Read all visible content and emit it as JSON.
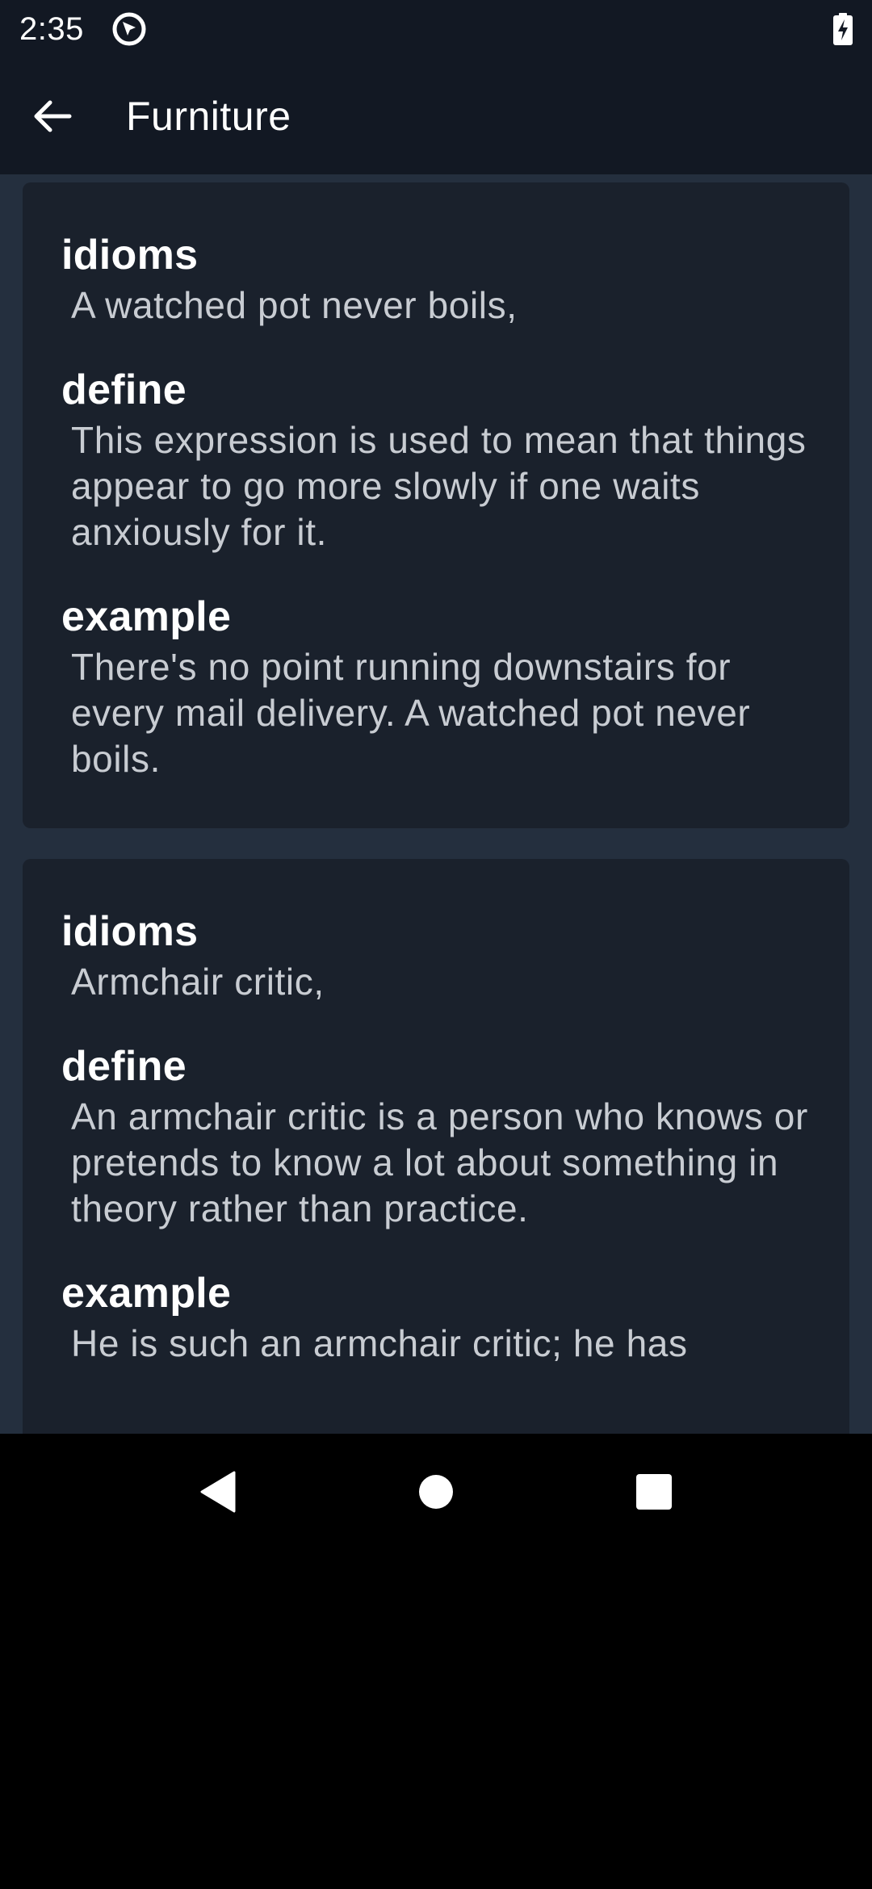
{
  "status_bar": {
    "time": "2:35",
    "app_icon": "app-notification-icon",
    "battery_icon": "battery-charging-icon"
  },
  "app_bar": {
    "back_icon": "arrow-back-icon",
    "title": "Furniture"
  },
  "cards": [
    {
      "idioms_label": "idioms",
      "idioms_value": "A watched pot never boils,",
      "define_label": "define",
      "define_value": "This expression is used to mean that things appear to go more slowly if one waits anxiously for it.",
      "example_label": "example",
      "example_value": "There's no point running downstairs for every mail delivery. A watched pot never boils."
    },
    {
      "idioms_label": "idioms",
      "idioms_value": "Armchair critic,",
      "define_label": "define",
      "define_value": "An armchair critic is a person who knows or pretends to know a lot about something in theory rather than practice.",
      "example_label": "example",
      "example_value": "He is such an armchair critic; he has"
    }
  ],
  "nav_bar": {
    "back_icon": "nav-back-triangle-icon",
    "home_icon": "nav-home-circle-icon",
    "recents_icon": "nav-recents-square-icon"
  },
  "colors": {
    "background": "#242f3e",
    "card": "#1a212c",
    "bar": "#121823",
    "label": "#ffffff",
    "value": "#c8ccd2"
  }
}
